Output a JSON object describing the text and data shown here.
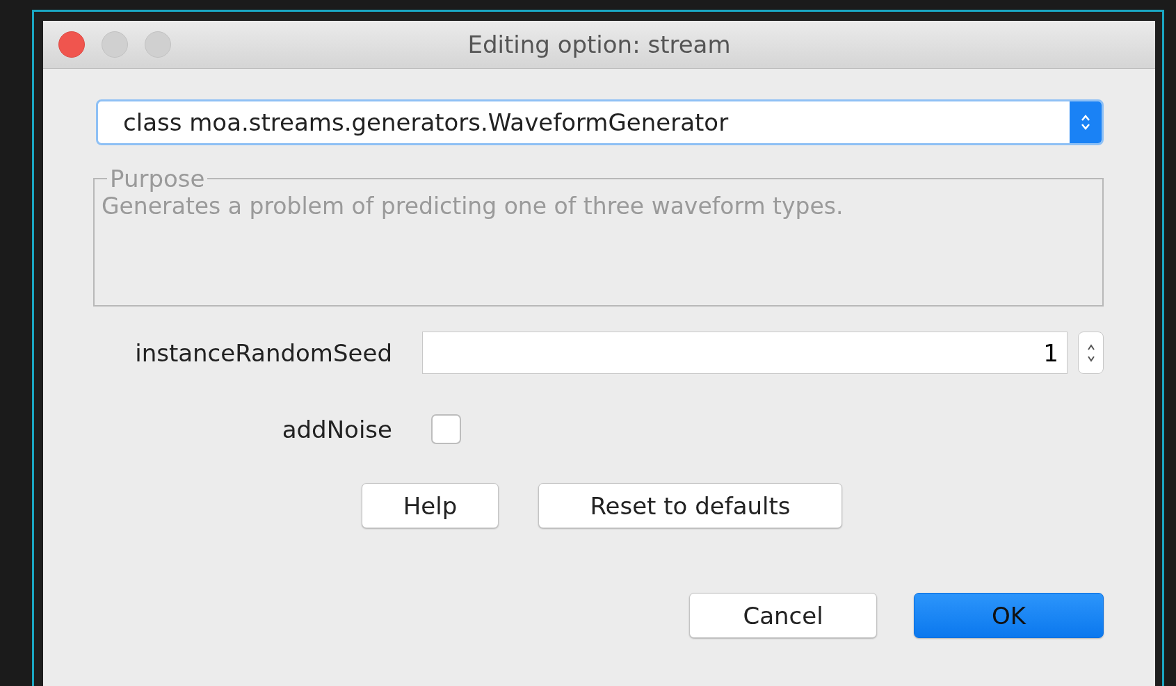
{
  "window": {
    "title": "Editing option: stream"
  },
  "class_select": {
    "value": "class moa.streams.generators.WaveformGenerator"
  },
  "purpose": {
    "legend": "Purpose",
    "text": "Generates a problem of predicting one of three waveform types."
  },
  "options": [
    {
      "kind": "number",
      "label": "instanceRandomSeed",
      "value": "1"
    },
    {
      "kind": "checkbox",
      "label": "addNoise",
      "checked": false
    }
  ],
  "option_buttons": [
    {
      "label": "Help"
    },
    {
      "label": "Reset to defaults"
    }
  ],
  "dialog_buttons": [
    {
      "label": "Cancel",
      "default": false
    },
    {
      "label": "OK",
      "default": true
    }
  ]
}
